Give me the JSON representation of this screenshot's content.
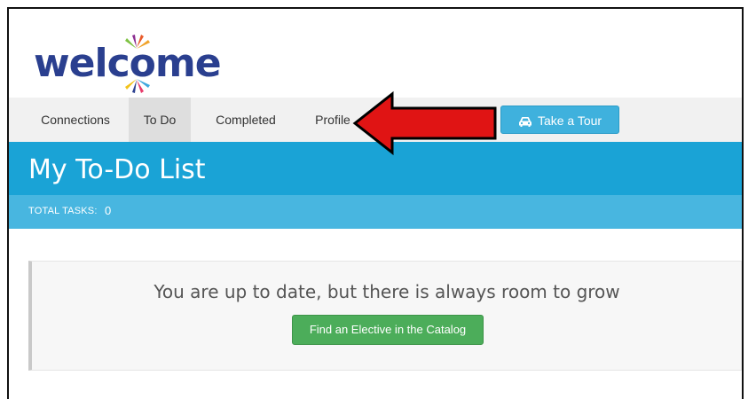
{
  "brand": {
    "logo_text": "welcome",
    "colors": {
      "logo_blue": "#2a3f8f",
      "accent_blue": "#1aa3d6",
      "green": "#4cad5a"
    }
  },
  "nav": {
    "items": [
      {
        "label": "Connections",
        "active": false
      },
      {
        "label": "To Do",
        "active": true
      },
      {
        "label": "Completed",
        "active": false
      },
      {
        "label": "Profile",
        "active": false
      }
    ],
    "tour_button": {
      "label": "Take a Tour",
      "icon": "car-icon"
    }
  },
  "header": {
    "title": "My To-Do List",
    "total_tasks_label": "TOTAL TASKS:",
    "total_tasks_value": "0"
  },
  "main": {
    "message": "You are up to date, but there is always room to grow",
    "cta_label": "Find an Elective in the Catalog"
  },
  "annotation": {
    "arrow_color": "#e01414",
    "arrow_points_to": "Profile"
  }
}
